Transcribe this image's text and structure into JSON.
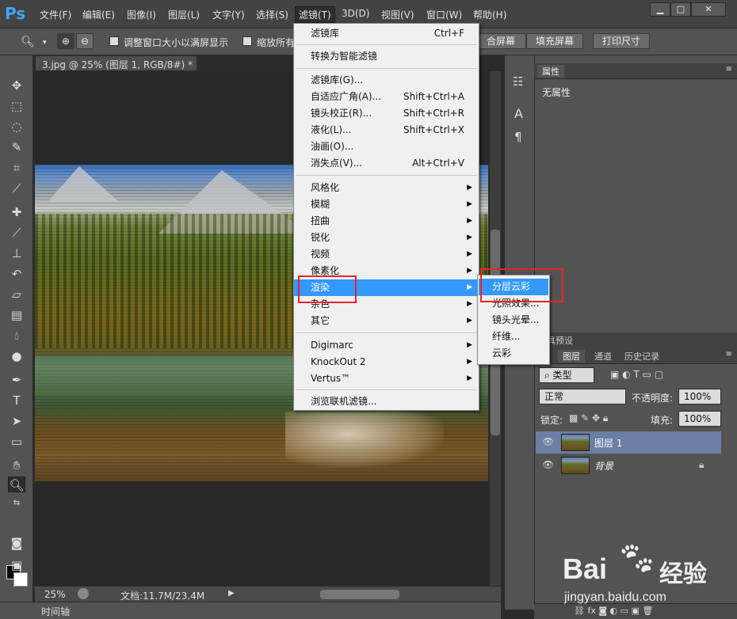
{
  "app": {
    "logo": "Ps",
    "menus": [
      "文件(F)",
      "编辑(E)",
      "图像(I)",
      "图层(L)",
      "文字(Y)",
      "选择(S)",
      "滤镜(T)",
      "3D(D)",
      "视图(V)",
      "窗口(W)",
      "帮助(H)"
    ],
    "window_controls": [
      "▁",
      "□",
      "✕"
    ]
  },
  "options_bar": {
    "resize_windows_label": "调整窗口大小以满屏显示",
    "zoom_all_label": "缩放所有",
    "fit_screen_label": "合屏幕",
    "fill_screen_label": "填充屏幕",
    "print_size_label": "打印尺寸"
  },
  "document": {
    "tab_label": "3.jpg @ 25% (图层 1, RGB/8#) *",
    "zoom": "25%",
    "doc_info": "文档:11.7M/23.4M"
  },
  "filter_menu": {
    "items": [
      {
        "label": "滤镜库",
        "shortcut": "Ctrl+F"
      },
      {
        "label": "转换为智能滤镜"
      },
      {
        "label": "滤镜库(G)..."
      },
      {
        "label": "自适应广角(A)...",
        "shortcut": "Shift+Ctrl+A"
      },
      {
        "label": "镜头校正(R)...",
        "shortcut": "Shift+Ctrl+R"
      },
      {
        "label": "液化(L)...",
        "shortcut": "Shift+Ctrl+X"
      },
      {
        "label": "油画(O)..."
      },
      {
        "label": "消失点(V)...",
        "shortcut": "Alt+Ctrl+V"
      },
      {
        "label": "风格化"
      },
      {
        "label": "模糊"
      },
      {
        "label": "扭曲"
      },
      {
        "label": "锐化"
      },
      {
        "label": "视频"
      },
      {
        "label": "像素化"
      },
      {
        "label": "渲染"
      },
      {
        "label": "杂色"
      },
      {
        "label": "其它"
      },
      {
        "label": "Digimarc"
      },
      {
        "label": "KnockOut 2"
      },
      {
        "label": "Vertus™"
      },
      {
        "label": "浏览联机滤镜..."
      }
    ]
  },
  "render_submenu": {
    "items": [
      "分层云彩",
      "光照效果...",
      "镜头光晕...",
      "纤维...",
      "云彩"
    ]
  },
  "properties_panel": {
    "tab": "属性",
    "content": "无属性"
  },
  "layers_panel": {
    "partial_tab": "具预设",
    "tabs": [
      "图层",
      "通道",
      "历史记录"
    ],
    "filter_kind": "类型",
    "blend_mode": "正常",
    "opacity_label": "不透明度:",
    "opacity_value": "100%",
    "lock_label": "锁定:",
    "fill_label": "填充:",
    "fill_value": "100%",
    "layers": [
      {
        "name": "图层 1",
        "selected": true
      },
      {
        "name": "背景",
        "locked": true
      }
    ]
  },
  "timeline": {
    "label": "时间轴"
  },
  "watermark": {
    "brand": "Bai",
    "brand_cn": "经验",
    "url": "jingyan.baidu.com"
  },
  "colors": {
    "highlight": "#3399ff",
    "annotation_red": "#e8232a",
    "ps_blue": "#3ea6ff"
  }
}
